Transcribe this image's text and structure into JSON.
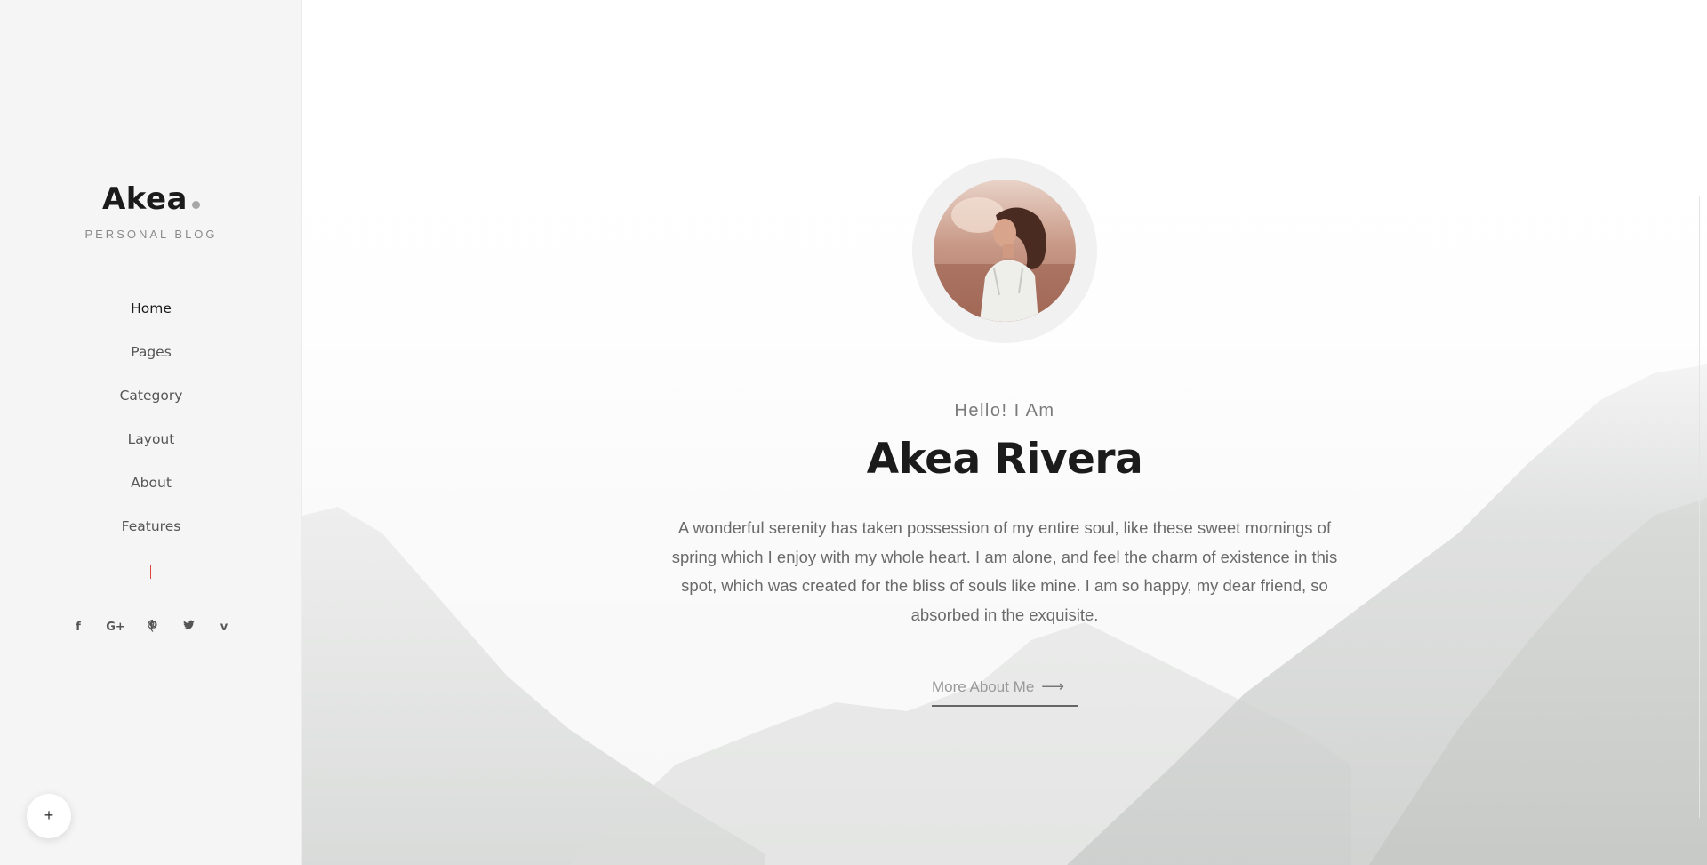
{
  "sidebar": {
    "logo": {
      "name": "Akea",
      "tagline": "PERSONAL BLOG"
    },
    "nav": [
      {
        "label": "Home",
        "active": true
      },
      {
        "label": "Pages",
        "active": false
      },
      {
        "label": "Category",
        "active": false
      },
      {
        "label": "Layout",
        "active": false
      },
      {
        "label": "About",
        "active": false
      },
      {
        "label": "Features",
        "active": false
      }
    ],
    "accent_color": "#e0463a",
    "socials": [
      {
        "icon": "facebook-icon",
        "glyph": "f"
      },
      {
        "icon": "google-plus-icon",
        "glyph": "G+"
      },
      {
        "icon": "pinterest-icon",
        "glyph": "℗"
      },
      {
        "icon": "twitter-icon",
        "glyph": "🐦"
      },
      {
        "icon": "vimeo-icon",
        "glyph": "v"
      }
    ],
    "fab": {
      "icon": "plus-icon",
      "glyph": "+"
    }
  },
  "hero": {
    "greeting": "Hello! I Am",
    "name": "Akea Rivera",
    "bio": "A wonderful serenity has taken possession of my entire soul, like these sweet mornings of spring which I enjoy with my whole heart. I am alone, and feel the charm of existence in this spot, which was created for the bliss of souls like mine. I am so happy, my dear friend, so absorbed in the exquisite.",
    "link": {
      "label": "More About Me",
      "icon": "arrow-right-icon",
      "glyph": "⟶"
    },
    "background": "mountain-landscape"
  }
}
